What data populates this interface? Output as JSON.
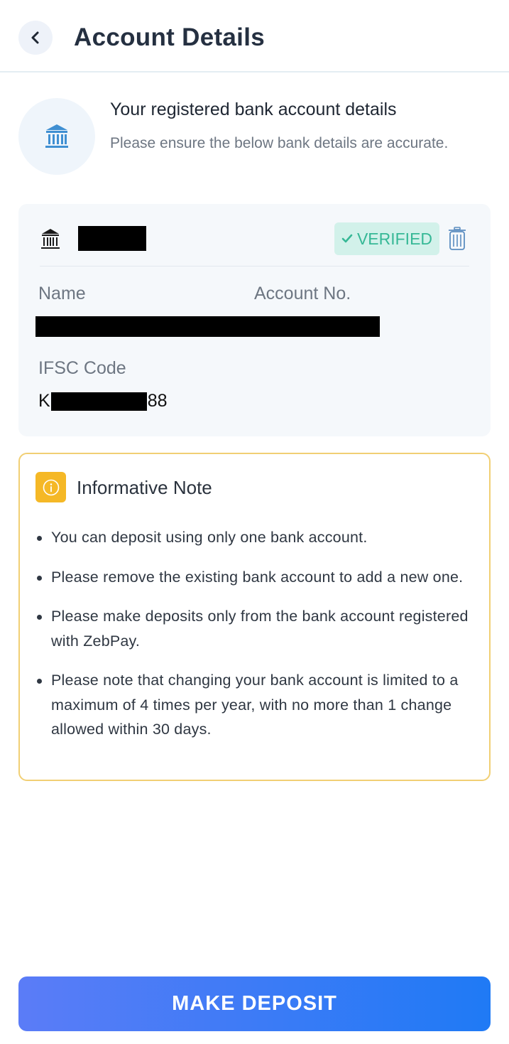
{
  "header": {
    "title": "Account Details",
    "back_icon": "chevron-left-icon"
  },
  "intro": {
    "title": "Your registered bank account details",
    "description": "Please ensure the below bank details are accurate.",
    "icon": "bank-icon"
  },
  "bank_card": {
    "bank_icon": "bank-icon",
    "status": "VERIFIED",
    "status_icon": "check-icon",
    "delete_icon": "trash-icon",
    "name_label": "Name",
    "account_label": "Account No.",
    "ifsc_label": "IFSC Code",
    "ifsc_prefix": "K",
    "ifsc_suffix": "88"
  },
  "note": {
    "icon": "info-icon",
    "title": "Informative Note",
    "items": [
      "You can deposit using only one bank account.",
      "Please remove the existing bank account to add a new one.",
      "Please make deposits only from the bank account registered with ZebPay.",
      "Please note that changing your bank account is limited to a maximum of 4 times per year, with no more than 1 change allowed within 30 days."
    ]
  },
  "cta": {
    "label": "MAKE DEPOSIT"
  },
  "colors": {
    "verified_text": "#36b896",
    "verified_bg": "#d2f1ea",
    "note_border": "#f1cf74",
    "note_icon_bg": "#f5b826",
    "cta_gradient_start": "#5b7cf7",
    "cta_gradient_end": "#1f7af5"
  }
}
